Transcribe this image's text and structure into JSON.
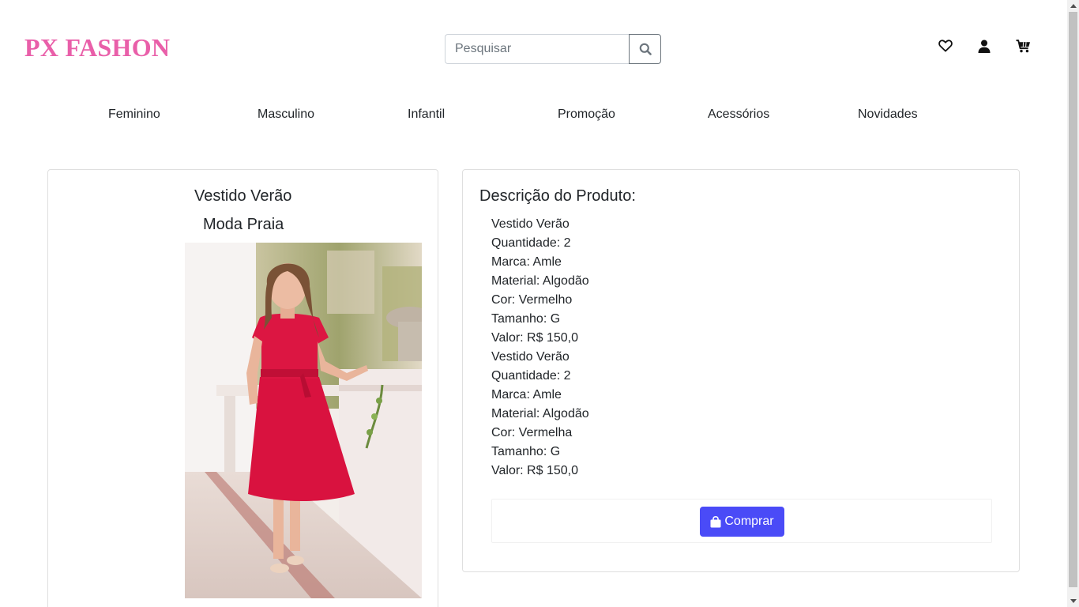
{
  "header": {
    "logo": "PX FASHON",
    "search_placeholder": "Pesquisar",
    "icons": [
      "heart-icon",
      "user-icon",
      "cart-icon"
    ]
  },
  "nav": {
    "items": [
      "Feminino",
      "Masculino",
      "Infantil",
      "Promoção",
      "Acessórios",
      "Novidades"
    ]
  },
  "product": {
    "title": "Vestido Verão",
    "subtitle": "Moda Praia",
    "image": "woman-in-red-dress-photo"
  },
  "description": {
    "title": "Descrição do Produto:",
    "lines": [
      "Vestido Verão",
      "Quantidade: 2",
      "Marca: Amle",
      "Material: Algodão",
      "Cor: Vermelho",
      "Tamanho: G",
      "Valor: R$ 150,0",
      "Vestido Verão",
      "Quantidade: 2",
      "Marca: Amle",
      "Material: Algodão",
      "Cor: Vermelha",
      "Tamanho: G",
      "Valor: R$ 150,0"
    ],
    "buy_label": "Comprar"
  },
  "colors": {
    "logo": "#e95fa9",
    "buy_button": "#4a4bf7",
    "dress": "#d9123f"
  }
}
